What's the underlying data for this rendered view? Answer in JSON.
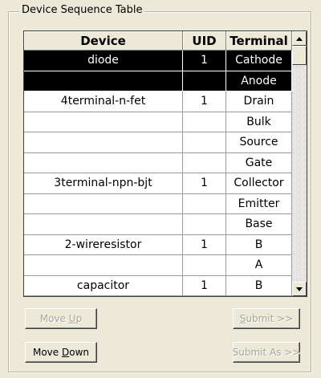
{
  "group": {
    "title": "Device Sequence Table"
  },
  "table": {
    "columns": [
      "Device",
      "UID",
      "Terminal"
    ],
    "rows": [
      {
        "device": "diode",
        "uid": "1",
        "terminal": "Cathode",
        "selected": true
      },
      {
        "device": "",
        "uid": "",
        "terminal": "Anode",
        "selected": true
      },
      {
        "device": "4terminal-n-fet",
        "uid": "1",
        "terminal": "Drain",
        "selected": false
      },
      {
        "device": "",
        "uid": "",
        "terminal": "Bulk",
        "selected": false
      },
      {
        "device": "",
        "uid": "",
        "terminal": "Source",
        "selected": false
      },
      {
        "device": "",
        "uid": "",
        "terminal": "Gate",
        "selected": false
      },
      {
        "device": "3terminal-npn-bjt",
        "uid": "1",
        "terminal": "Collector",
        "selected": false
      },
      {
        "device": "",
        "uid": "",
        "terminal": "Emitter",
        "selected": false
      },
      {
        "device": "",
        "uid": "",
        "terminal": "Base",
        "selected": false
      },
      {
        "device": "2-wireresistor",
        "uid": "1",
        "terminal": "B",
        "selected": false
      },
      {
        "device": "",
        "uid": "",
        "terminal": "A",
        "selected": false
      },
      {
        "device": "capacitor",
        "uid": "1",
        "terminal": "B",
        "selected": false
      }
    ]
  },
  "buttons": {
    "move_up": {
      "label": "Move Up",
      "mnemonic": "U",
      "enabled": false
    },
    "move_down": {
      "label": "Move Down",
      "mnemonic": "D",
      "enabled": true
    },
    "submit": {
      "label": "Submit >>",
      "mnemonic": "S",
      "enabled": false
    },
    "submit_as": {
      "label": "Submit As >>",
      "mnemonic": "",
      "enabled": false
    }
  },
  "colors": {
    "window_bg": "#ece9d8",
    "selection_bg": "#000000",
    "selection_fg": "#ffffff",
    "disabled_text": "#a8a59a"
  },
  "icons": {
    "scroll_up": "triangle-up-icon",
    "scroll_down": "triangle-down-icon"
  }
}
